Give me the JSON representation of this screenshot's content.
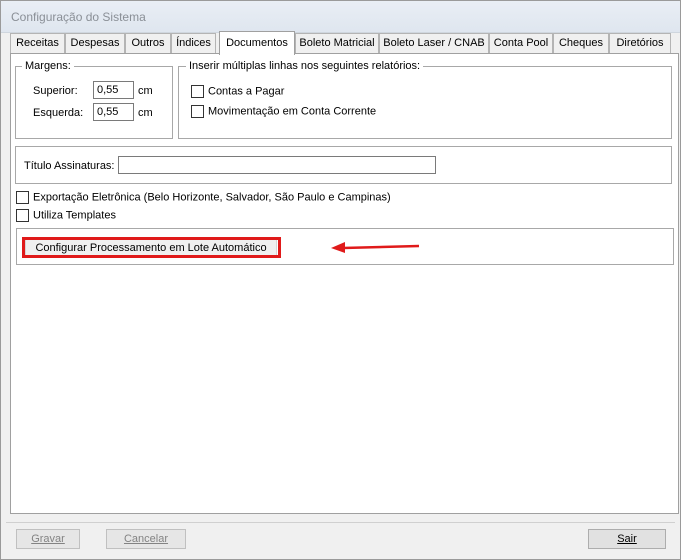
{
  "window": {
    "title": "Configuração do Sistema"
  },
  "tabs": [
    {
      "label": "Receitas"
    },
    {
      "label": "Despesas"
    },
    {
      "label": "Outros"
    },
    {
      "label": "Índices"
    },
    {
      "label": "Documentos"
    },
    {
      "label": "Boleto Matricial"
    },
    {
      "label": "Boleto Laser / CNAB"
    },
    {
      "label": "Conta Pool"
    },
    {
      "label": "Cheques"
    },
    {
      "label": "Diretórios"
    }
  ],
  "active_tab": "Documentos",
  "margins": {
    "group_label": "Margens:",
    "superior_label": "Superior:",
    "superior_value": "0,55",
    "esquerda_label": "Esquerda:",
    "esquerda_value": "0,55",
    "unit": "cm"
  },
  "multi_lines": {
    "group_label": "Inserir múltiplas linhas nos seguintes relatórios:",
    "contas_label": "Contas a Pagar",
    "movimentacao_label": "Movimentação em Conta Corrente"
  },
  "titulo": {
    "label": "Título Assinaturas:",
    "value": ""
  },
  "exportacao_label": "Exportação Eletrônica (Belo Horizonte, Salvador, São Paulo e Campinas)",
  "templates_label": "Utiliza Templates",
  "config_button_label": "Configurar Processamento em Lote Automático",
  "annotation_color": "#e01a1a",
  "footer": {
    "gravar_label": "Gravar",
    "cancelar_label": "Cancelar",
    "sair_label": "Sair"
  }
}
